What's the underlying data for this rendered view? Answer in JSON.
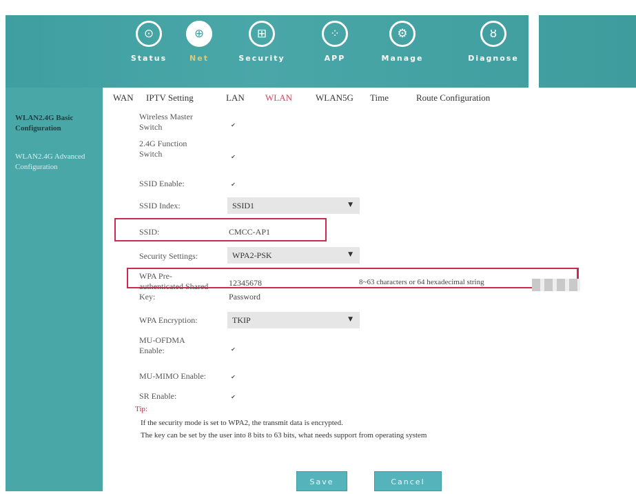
{
  "nav": {
    "items": [
      {
        "label": "Status",
        "icon": "status-icon",
        "glyph": "⊙",
        "active": false
      },
      {
        "label": "Net",
        "icon": "globe-icon",
        "glyph": "⊕",
        "active": true
      },
      {
        "label": "Security",
        "icon": "shield-icon",
        "glyph": "⊞",
        "active": false
      },
      {
        "label": "APP",
        "icon": "apps-icon",
        "glyph": "⁘",
        "active": false
      },
      {
        "label": "Manage",
        "icon": "gear-icon",
        "glyph": "⚙",
        "active": false
      },
      {
        "label": "Diagnose",
        "icon": "stethoscope-icon",
        "glyph": "ȣ",
        "active": false
      }
    ]
  },
  "subnav": {
    "items": [
      "WAN",
      "IPTV Setting",
      "LAN",
      "WLAN",
      "WLAN5G",
      "Time",
      "Route Configuration"
    ],
    "active": "WLAN"
  },
  "sidebar": {
    "items": [
      {
        "label": "WLAN2.4G Basic Configuration",
        "active": true
      },
      {
        "label": "WLAN2.4G Advanced Configuration",
        "active": false
      }
    ]
  },
  "form": {
    "wireless_master_switch": "Wireless Master Switch",
    "function_switch": "2.4G Function Switch",
    "ssid_enable": "SSID Enable:",
    "ssid_index": "SSID Index:",
    "ssid_index_value": "SSID1",
    "ssid_label": "SSID:",
    "ssid_value": "CMCC-AP1",
    "security_settings": "Security Settings:",
    "security_value": "WPA2-PSK",
    "wpa_key_label": "WPA Pre-authenticated Shared Key:",
    "wpa_key_value": "12345678",
    "wpa_key_hint": "8~63 characters or 64 hexadecimal string",
    "password_label": "Password",
    "wpa_encryption": "WPA Encryption:",
    "wpa_encryption_value": "TKIP",
    "mu_ofdma": "MU-OFDMA Enable:",
    "mu_mimo": "MU-MIMO Enable:",
    "sr_enable": "SR Enable:",
    "check_glyph": "✔",
    "arrow_glyph": "▼"
  },
  "tip": {
    "title": "Tip:",
    "line1": "If the security mode is set to WPA2, the transmit data is encrypted.",
    "line2": "The key can be set by the user into 8 bits to 63 bits, what needs support from operating system"
  },
  "buttons": {
    "save": "Save",
    "cancel": "Cancel"
  },
  "colors": {
    "accent": "#4aa7a8",
    "highlight": "#d0294d",
    "active_tab": "#d64560"
  }
}
